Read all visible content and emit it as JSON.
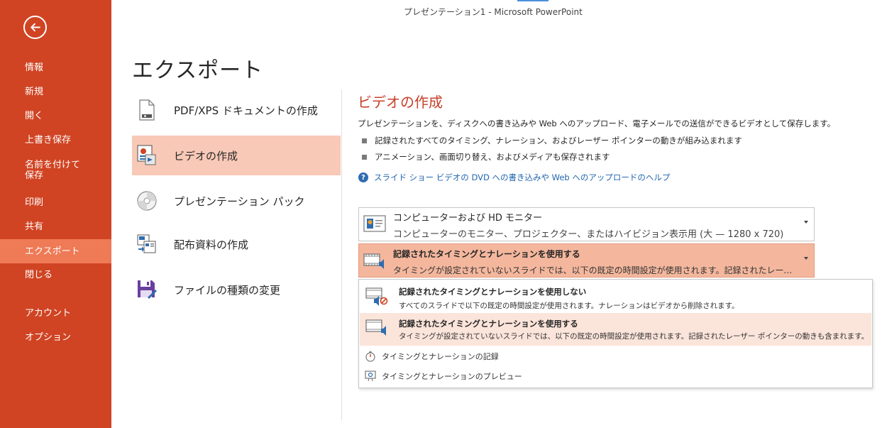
{
  "window": {
    "title": "プレゼンテーション1 - Microsoft PowerPoint"
  },
  "nav": {
    "back_icon": "back-arrow-icon",
    "items": [
      {
        "label": "情報"
      },
      {
        "label": "新規"
      },
      {
        "label": "開く"
      },
      {
        "label": "上書き保存"
      },
      {
        "label_line1": "名前を付けて",
        "label_line2": "保存"
      },
      {
        "label": "印刷"
      },
      {
        "label": "共有"
      },
      {
        "label": "エクスポート",
        "active": true
      },
      {
        "label": "閉じる"
      },
      {
        "label": "アカウント"
      },
      {
        "label": "オプション"
      }
    ]
  },
  "page": {
    "title": "エクスポート"
  },
  "export_options": [
    {
      "label": "PDF/XPS ドキュメントの作成",
      "icon": "pdf-document-icon"
    },
    {
      "label": "ビデオの作成",
      "icon": "video-create-icon",
      "selected": true
    },
    {
      "label": "プレゼンテーション パック",
      "icon": "cd-package-icon"
    },
    {
      "label": "配布資料の作成",
      "icon": "handout-icon"
    },
    {
      "label": "ファイルの種類の変更",
      "icon": "save-filetype-icon"
    }
  ],
  "detail": {
    "title": "ビデオの作成",
    "description": "プレゼンテーションを、ディスクへの書き込みや Web へのアップロード、電子メールでの送信ができるビデオとして保存します。",
    "bullets": [
      "記録されたすべてのタイミング、ナレーション、およびレーザー ポインターの動きが組み込まれます",
      "アニメーション、画面切り替え、およびメディアも保存されます"
    ],
    "help_link": "スライド ショー ビデオの DVD への書き込みや Web へのアップロードのヘルプ",
    "quality_dropdown": {
      "title": "コンピューターおよび HD モニター",
      "subtitle": "コンピューターのモニター、プロジェクター、またはハイビジョン表示用 (大 — 1280 x 720)"
    },
    "timing_dropdown": {
      "title": "記録されたタイミングとナレーションを使用する",
      "subtitle": "タイミングが設定されていないスライドでは、以下の既定の時間設定が使用されます。記録されたレーザー ポインターの動きも含まれます。"
    },
    "timing_menu": {
      "options": [
        {
          "title": "記録されたタイミングとナレーションを使用しない",
          "description": "すべてのスライドで以下の既定の時間設定が使用されます。ナレーションはビデオから削除されます。"
        },
        {
          "title": "記録されたタイミングとナレーションを使用する",
          "description": "タイミングが設定されていないスライドでは、以下の既定の時間設定が使用されます。記録されたレーザー ポインターの動きも含まれます。",
          "highlighted": true
        }
      ],
      "record_link": "タイミングとナレーションの記録",
      "preview_link": "タイミングとナレーションのプレビュー"
    }
  },
  "colors": {
    "nav_bg": "#d04423",
    "nav_active": "#ee7a56",
    "option_selected": "#f8c9b6",
    "accent_title": "#c8402a",
    "link": "#2266b0"
  }
}
